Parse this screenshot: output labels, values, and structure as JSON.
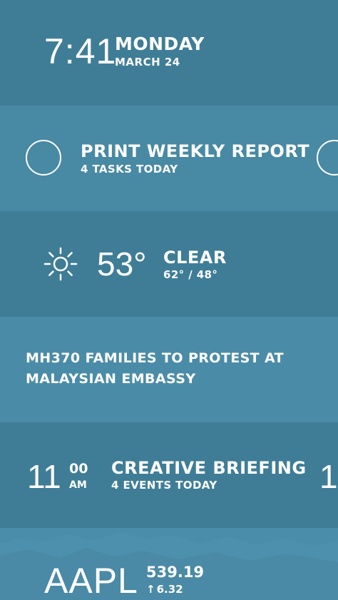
{
  "time_card": {
    "time": "7:41",
    "day": "MONDAY",
    "date": "MARCH 24"
  },
  "task_card": {
    "title": "PRINT WEEKLY REPORT",
    "subtitle": "4 TASKS TODAY",
    "icon": "circle-checkbox-icon"
  },
  "weather_card": {
    "icon": "sun-icon",
    "temperature": "53°",
    "condition": "CLEAR",
    "range": "62° / 48°"
  },
  "news_card": {
    "headline": "MH370 FAMILIES TO PROTEST AT MALAYSIAN EMBASSY"
  },
  "calendar_card": {
    "hour": "11",
    "minutes": "00",
    "ampm": "AM",
    "title": "CREATIVE BRIEFING",
    "subtitle": "4 EVENTS TODAY",
    "next_hour_peek": "1"
  },
  "stock_card": {
    "ticker": "AAPL",
    "price": "539.19",
    "arrow": "↑",
    "change": "6.32"
  },
  "colors": {
    "band_dark": "#3f7d97",
    "band_light": "#4889a4",
    "text": "#ffffff"
  }
}
